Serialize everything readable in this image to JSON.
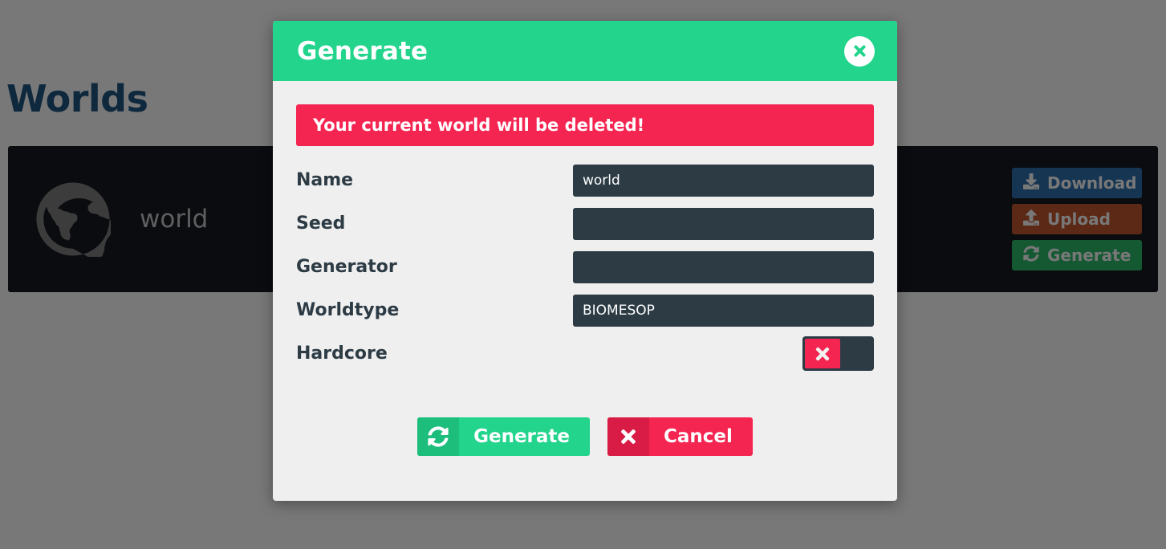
{
  "page": {
    "title": "Worlds",
    "world_card": {
      "globe_icon": "globe-icon",
      "world_name": "world",
      "actions": [
        {
          "label": "Download",
          "icon": "download-icon",
          "color": "#2f72b1"
        },
        {
          "label": "Upload",
          "icon": "upload-icon",
          "color": "#c2572d"
        },
        {
          "label": "Generate",
          "icon": "refresh-icon",
          "color": "#2dbd6e"
        }
      ]
    }
  },
  "modal": {
    "title": "Generate",
    "close_icon": "close-icon",
    "warning": "Your current world will be deleted!",
    "fields": [
      {
        "label": "Name",
        "value": "world",
        "placeholder": "",
        "type": "text"
      },
      {
        "label": "Seed",
        "value": "",
        "placeholder": "",
        "type": "text"
      },
      {
        "label": "Generator",
        "value": "",
        "placeholder": "",
        "type": "text"
      },
      {
        "label": "Worldtype",
        "value": "BIOMESOP",
        "placeholder": "",
        "type": "text"
      },
      {
        "label": "Hardcore",
        "value": "off",
        "type": "toggle",
        "toggle_icon": "x-icon"
      }
    ],
    "buttons": [
      {
        "label": "Generate",
        "icon": "refresh-icon",
        "color": "#22d48c"
      },
      {
        "label": "Cancel",
        "icon": "x-icon",
        "color": "#f52552"
      }
    ]
  },
  "colors": {
    "header_green": "#22d48c",
    "danger_red": "#f52552",
    "input_dark": "#2d3b45",
    "card_dark": "#161b22",
    "title_blue": "#1f5582",
    "modal_body": "#efefef"
  }
}
